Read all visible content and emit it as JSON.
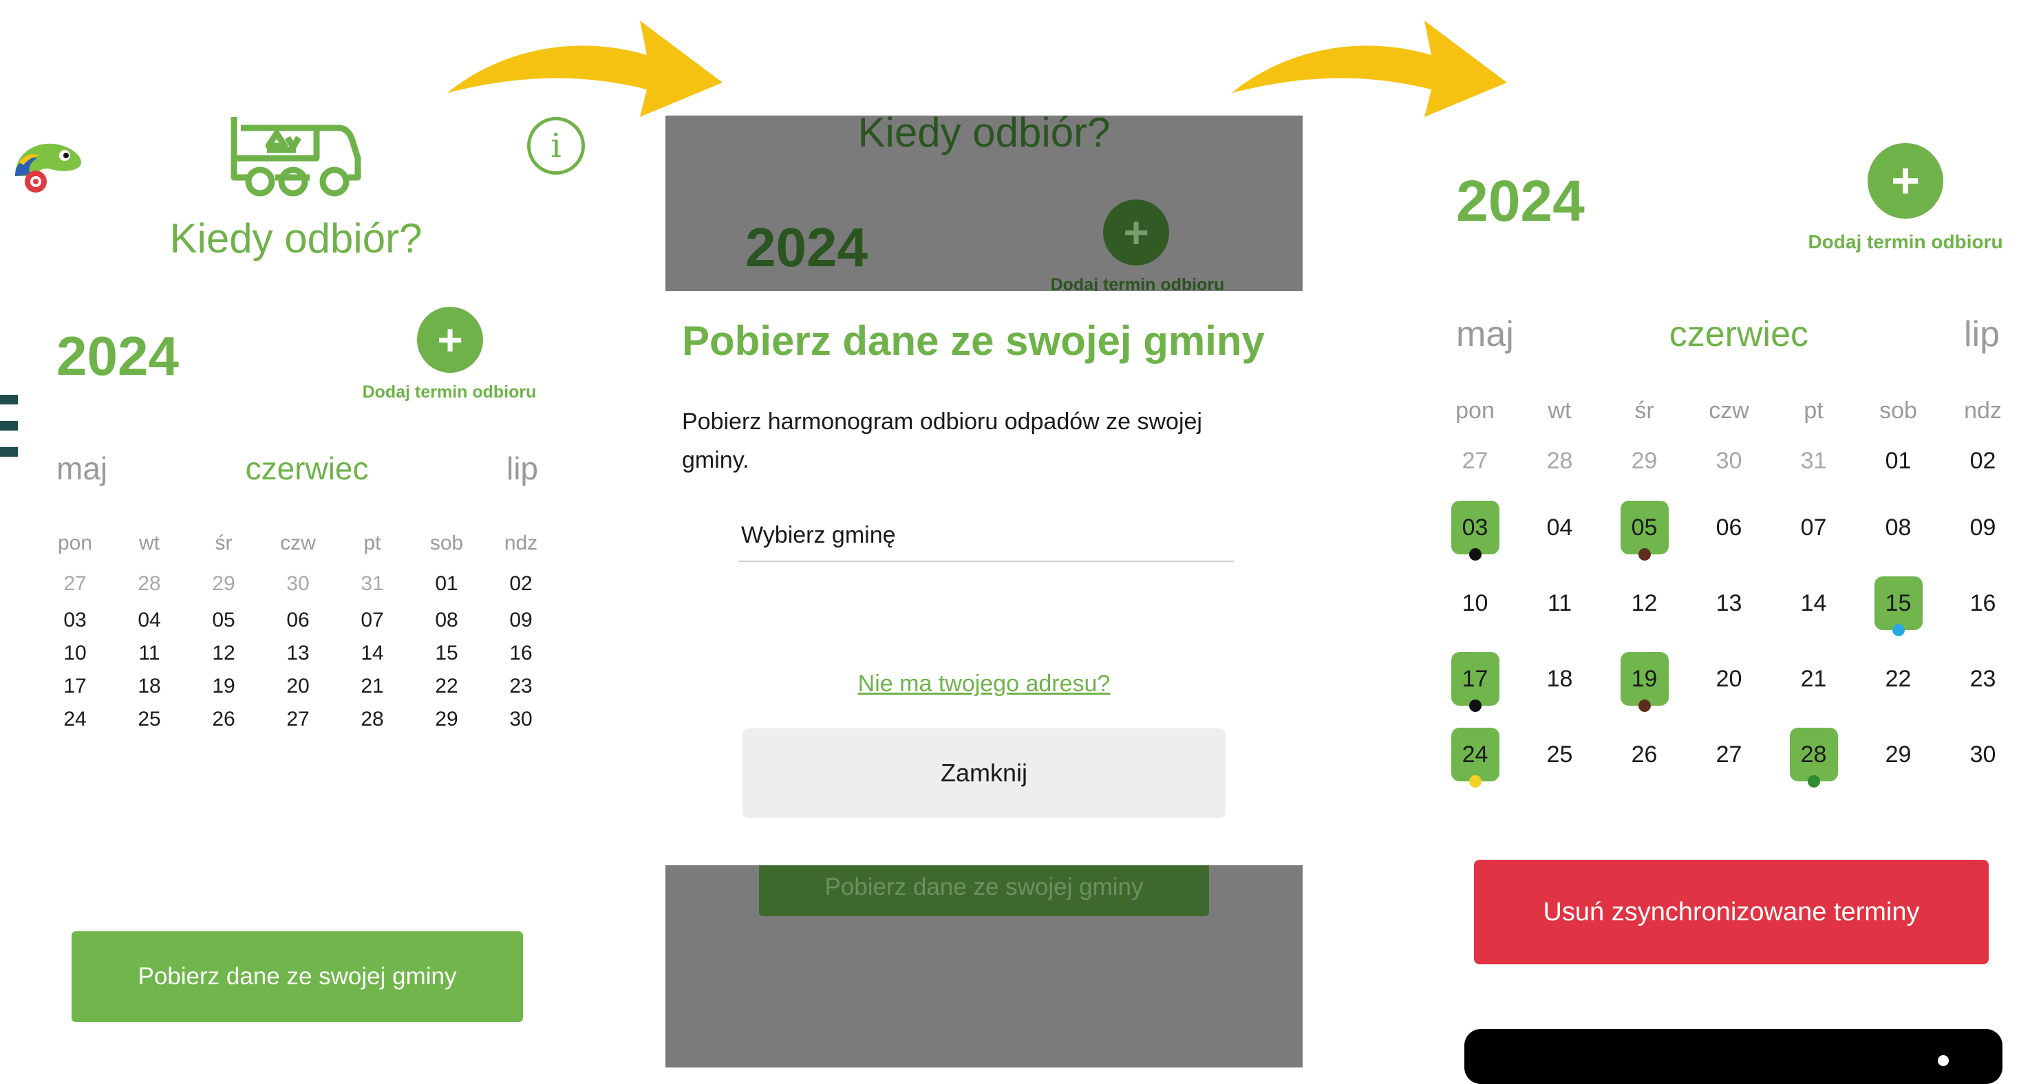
{
  "colors": {
    "accent": "#6fb24a",
    "arrow": "#f5c211",
    "danger": "#e03343",
    "overlay": "#7b7b7b"
  },
  "panel1": {
    "app_title": "Kiedy odbiór?",
    "info_icon": "info-icon",
    "year": "2024",
    "add_button_icon": "+",
    "add_label": "Dodaj termin odbioru",
    "months": {
      "prev": "maj",
      "current": "czerwiec",
      "next": "lip"
    },
    "weekdays": [
      "pon",
      "wt",
      "śr",
      "czw",
      "pt",
      "sob",
      "ndz"
    ],
    "days": [
      "27",
      "28",
      "29",
      "30",
      "31",
      "01",
      "02",
      "03",
      "04",
      "05",
      "06",
      "07",
      "08",
      "09",
      "10",
      "11",
      "12",
      "13",
      "14",
      "15",
      "16",
      "17",
      "18",
      "19",
      "20",
      "21",
      "22",
      "23",
      "24",
      "25",
      "26",
      "27",
      "28",
      "29",
      "30"
    ],
    "muted_count": 5,
    "fetch_button": "Pobierz dane ze swojej gminy"
  },
  "panel2": {
    "bg_title": "Kiedy odbiór?",
    "bg_year": "2024",
    "bg_add_label": "Dodaj termin odbioru",
    "bg_fetch_button": "Pobierz dane ze swojej gminy",
    "modal_title": "Pobierz dane ze swojej gminy",
    "modal_text": "Pobierz harmonogram odbioru odpadów ze swojej gminy.",
    "select_value": "Wybierz gminę",
    "link_text": "Nie ma twojego adresu?",
    "close_button": "Zamknij"
  },
  "panel3": {
    "year": "2024",
    "add_button_icon": "+",
    "add_label": "Dodaj termin odbioru",
    "months": {
      "prev": "maj",
      "current": "czerwiec",
      "next": "lip"
    },
    "weekdays": [
      "pon",
      "wt",
      "śr",
      "czw",
      "pt",
      "sob",
      "ndz"
    ],
    "days": [
      "27",
      "28",
      "29",
      "30",
      "31",
      "01",
      "02",
      "03",
      "04",
      "05",
      "06",
      "07",
      "08",
      "09",
      "10",
      "11",
      "12",
      "13",
      "14",
      "15",
      "16",
      "17",
      "18",
      "19",
      "20",
      "21",
      "22",
      "23",
      "24",
      "25",
      "26",
      "27",
      "28",
      "29",
      "30"
    ],
    "muted_count": 5,
    "highlights": [
      {
        "day": "03",
        "dot": "#111111"
      },
      {
        "day": "05",
        "dot": "#5b2e1e"
      },
      {
        "day": "15",
        "dot": "#29a8e0"
      },
      {
        "day": "17",
        "dot": "#111111"
      },
      {
        "day": "19",
        "dot": "#5b2e1e"
      },
      {
        "day": "24",
        "dot": "#f2d024"
      },
      {
        "day": "28",
        "dot": "#2e8b2e"
      }
    ],
    "delete_button": "Usuń zsynchronizowane terminy"
  }
}
